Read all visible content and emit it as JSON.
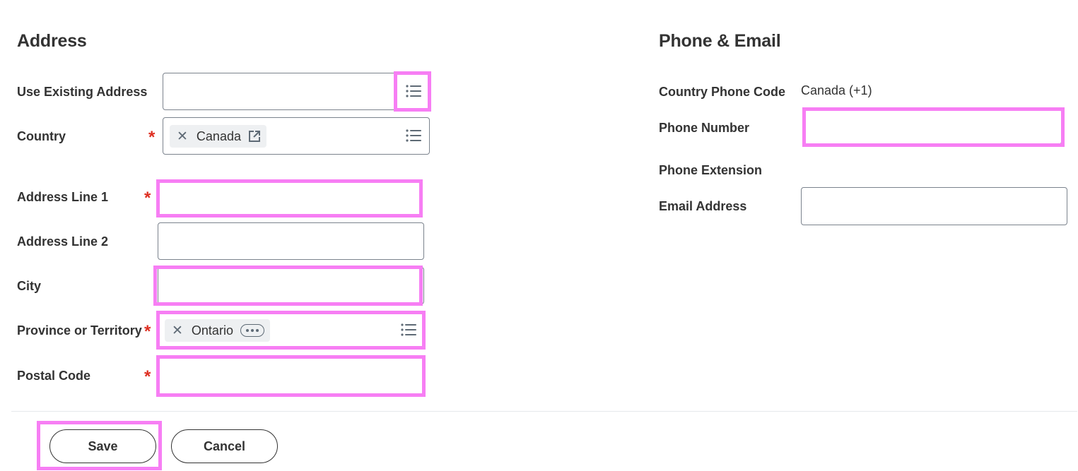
{
  "address": {
    "title": "Address",
    "use_existing_label": "Use Existing Address",
    "country_label": "Country",
    "country_value": "Canada",
    "address_line1_label": "Address Line 1",
    "address_line2_label": "Address Line 2",
    "city_label": "City",
    "province_label": "Province or Territory",
    "province_value": "Ontario",
    "postal_code_label": "Postal Code",
    "required_marker": "*"
  },
  "contact": {
    "title": "Phone & Email",
    "country_phone_code_label": "Country Phone Code",
    "country_phone_code_value": "Canada (+1)",
    "phone_number_label": "Phone Number",
    "phone_extension_label": "Phone Extension",
    "email_label": "Email Address"
  },
  "actions": {
    "save_label": "Save",
    "cancel_label": "Cancel"
  },
  "icons": {
    "list": "list-icon",
    "clear": "close-icon",
    "external_link": "external-link-icon",
    "more": "more-options-icon"
  },
  "colors": {
    "highlight": "#f77ef4",
    "required": "#de2e21",
    "text": "#333333",
    "border": "#7b838d"
  }
}
